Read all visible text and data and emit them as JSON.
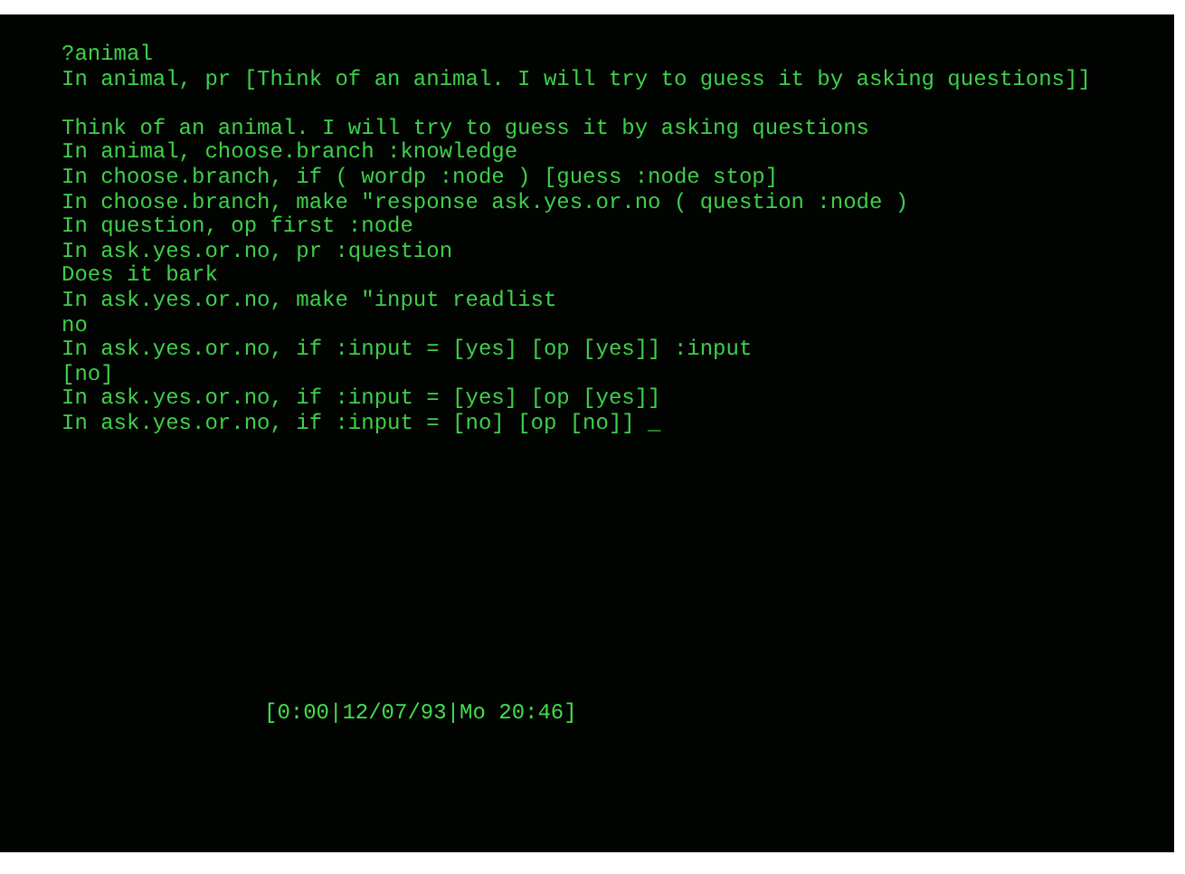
{
  "terminal": {
    "blocks": [
      {
        "lines": [
          "?animal",
          "In animal, pr [Think of an animal. I will try to guess it by asking questions]]"
        ]
      },
      {
        "lines": [
          "Think of an animal. I will try to guess it by asking questions",
          "In animal, choose.branch :knowledge",
          "In choose.branch, if ( wordp :node ) [guess :node stop]",
          "In choose.branch, make \"response ask.yes.or.no ( question :node )",
          "In question, op first :node",
          "In ask.yes.or.no, pr :question",
          "Does it bark",
          "In ask.yes.or.no, make \"input readlist",
          "no",
          "In ask.yes.or.no, if :input = [yes] [op [yes]] :input",
          "[no]",
          "In ask.yes.or.no, if :input = [yes] [op [yes]]",
          "In ask.yes.or.no, if :input = [no] [op [no]] _"
        ]
      }
    ],
    "status": "[0:00|12/07/93|Mo 20:46]"
  }
}
